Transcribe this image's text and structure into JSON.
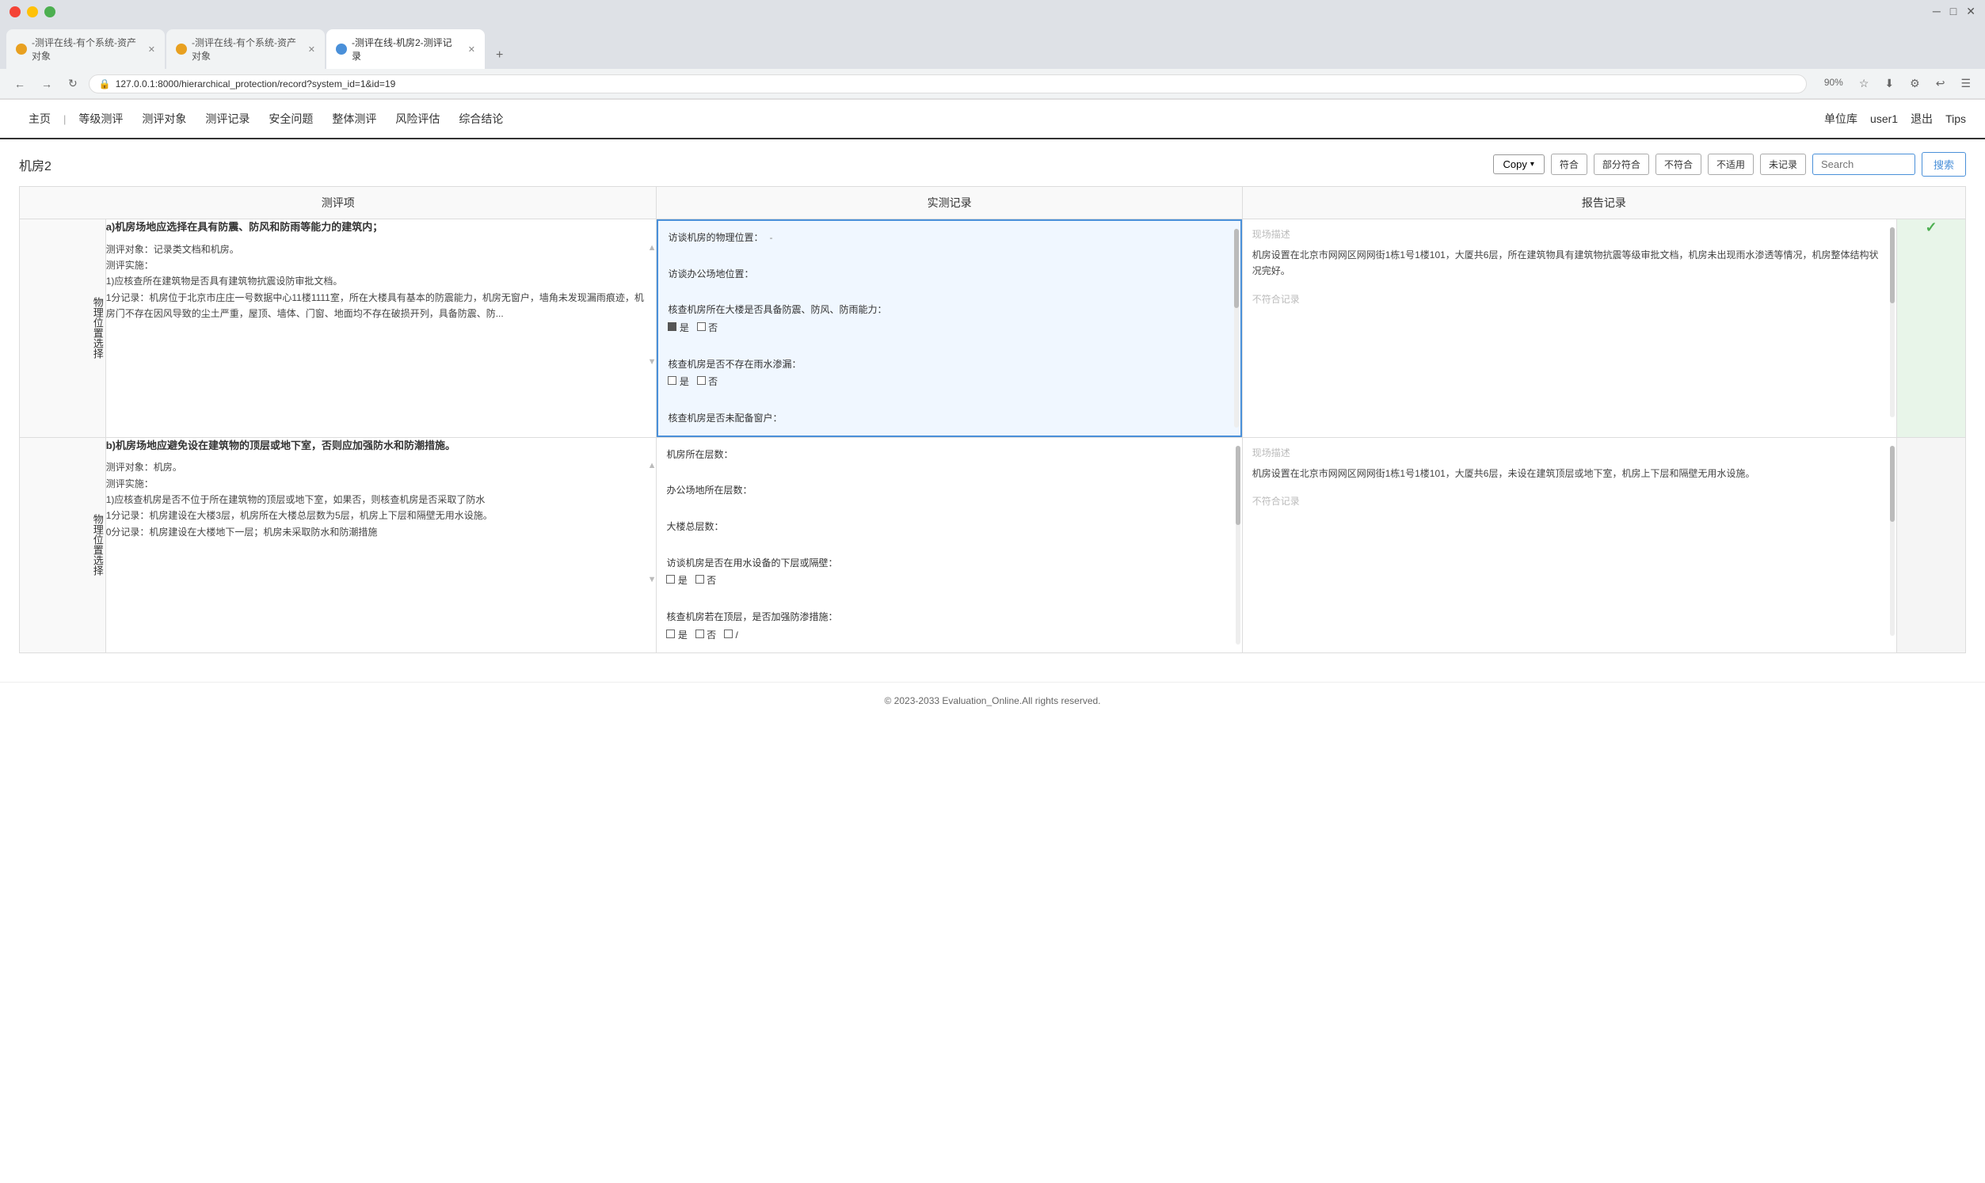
{
  "browser": {
    "tabs": [
      {
        "label": "-测评在线-有个系统-资产对象",
        "icon_color": "orange",
        "active": false
      },
      {
        "label": "-测评在线-有个系统-资产对象",
        "icon_color": "orange",
        "active": false
      },
      {
        "label": "-测评在线-机房2-测评记录",
        "icon_color": "blue",
        "active": true
      }
    ],
    "address": "127.0.0.1:8000/hierarchical_protection/record?system_id=1&id=19",
    "zoom": "90%"
  },
  "nav": {
    "items": [
      "主页",
      "等级测评",
      "测评对象",
      "测评记录",
      "安全问题",
      "整体测评",
      "风险评估",
      "综合结论"
    ],
    "right_items": [
      "单位库",
      "user1",
      "退出",
      "Tips"
    ]
  },
  "page": {
    "title": "机房2",
    "copy_label": "Copy",
    "filter_buttons": [
      "符合",
      "部分符合",
      "不符合",
      "不适用",
      "未记录"
    ],
    "search_placeholder": "Search",
    "search_btn": "搜索"
  },
  "table": {
    "headers": [
      "测评项",
      "实测记录",
      "报告记录"
    ],
    "rows": [
      {
        "category": "物理位置选择",
        "eval_title": "a)机房场地应选择在具有防震、防风和防雨等能力的建筑内；",
        "eval_content": "测评对象：记录类文档和机房。\n测评实施：\n1)应核查所在建筑物是否具有建筑物抗震设防审批文档。\n1分记录：机房位于北京市庄庄一号数据中心11楼1111室，所在大楼具有基本的防震能力，机房无窗户，墙角未发现漏雨痕迹，机房门不存在因风导致的尘土严重，屋顶、墙体、门窗、地面均不存在破损开列，具备防震、防...",
        "record_highlighted": true,
        "record_content": "访谈机房的物理位置：\n\n访谈办公场地位置：\n\n核查机房所在大楼是否具备防震、防风、防雨能力：\n■ 是  □ 否\n\n核查机房是否不存在雨水渗漏：\n□ 是  □ 否\n\n核查机房是否未配备窗户：",
        "report_placeholder": "现场描述",
        "report_content": "机房设置在北京市网网区网网街1栋1号1楼101，大厦共6层，所在建筑物具有建筑物抗震等级审批文档，机房未出现雨水渗透等情况，机房整体结构状况完好。",
        "not_conform": "不符合记录",
        "status": "✓",
        "status_show": true
      },
      {
        "category": "物理位置选择",
        "eval_title": "b)机房场地应避免设在建筑物的顶层或地下室，否则应加强防水和防潮措施。",
        "eval_content": "测评对象：机房。\n测评实施：\n1)应核查机房是否不位于所在建筑物的顶层或地下室，如果否，则核查机房是否采取了防水\n1分记录：机房建设在大楼3层，机房所在大楼总层数为5层，机房上下层和隔壁无用水设施。\n0分记录：机房建设在大楼地下一层；机房未采取防水和防潮措施",
        "record_highlighted": false,
        "record_content": "机房所在层数：\n\n办公场地所在层数：\n\n大楼总层数：\n\n访谈机房是否在用水设备的下层或隔壁：\n□ 是  □ 否\n\n核查机房若在顶层，是否加强防渗措施：\n□ 是  □ 否  □ /",
        "report_placeholder": "现场描述",
        "report_content": "机房设置在北京市网网区网网街1栋1号1楼101，大厦共6层，未设在建筑顶层或地下室，机房上下层和隔壁无用水设施。",
        "not_conform": "不符合记录",
        "status": "",
        "status_show": false
      }
    ]
  },
  "footer": {
    "text": "© 2023-2033 Evaluation_Online.All rights reserved."
  }
}
